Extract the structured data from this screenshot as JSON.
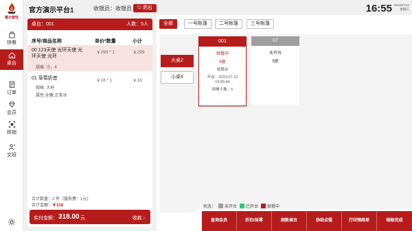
{
  "brand": {
    "logo_text": "蜀大智饮"
  },
  "sidebar": {
    "items": [
      {
        "label": "快餐",
        "icon": "fast-food-icon",
        "active": false
      },
      {
        "label": "桌台",
        "icon": "home-icon",
        "active": true
      },
      {
        "label": "订单",
        "icon": "receipt-icon",
        "active": false
      },
      {
        "label": "会员",
        "icon": "diamond-icon",
        "active": false
      },
      {
        "label": "核销",
        "icon": "scan-icon",
        "active": false
      },
      {
        "label": "交班",
        "icon": "user-shift-icon",
        "active": false
      }
    ],
    "bottom_icon": "gear-icon"
  },
  "header": {
    "title": "官方演示平台1",
    "cashier": "收银员：收银员",
    "logout": "退出",
    "time": "16:55",
    "date": "2023/07/12",
    "weekday": "星期三"
  },
  "order": {
    "table_label": "桌台：001",
    "people_label": "人数：5人",
    "columns": {
      "name": "序号/商品名称",
      "price_qty": "单价*数量",
      "subtotal": "小计"
    },
    "items": [
      {
        "name": "00 123天使 光环天使 光环天使 光环",
        "price_qty": "￥299 * 1",
        "subtotal": "￥299",
        "spec": "规格: 冷，4",
        "attrs": "",
        "selected": true
      },
      {
        "name": "01 草莓奶昔",
        "price_qty": "￥18 * 1",
        "subtotal": "￥18",
        "spec": "规格: 大杯",
        "attrs": "属性:全糖,正常冰",
        "selected": false
      }
    ],
    "total_qty": "合计数量：2 件（服务费：1元）",
    "total_amount_label": "合计金额：",
    "total_amount": "￥318",
    "pay_label": "实付金额：",
    "pay_amount": "318.00",
    "pay_unit": "元",
    "pay_button": "收款"
  },
  "areas": {
    "tabs": [
      {
        "label": "全部",
        "active": true
      },
      {
        "label": "一号帐篷",
        "active": false
      },
      {
        "label": "二号帐篷",
        "active": false
      },
      {
        "label": "三号帐篷",
        "active": false
      }
    ],
    "zones": [
      {
        "label": "大桌2",
        "active": true
      },
      {
        "label": "小桌4",
        "active": false
      }
    ]
  },
  "tables": [
    {
      "number": "001",
      "status": "就餐中",
      "seats": "5座",
      "cashier": "收银台",
      "open_label": "开台：",
      "open_date": "2023-07-12",
      "open_time": "16:55:44",
      "diners": "用餐人数：5",
      "busy": true
    },
    {
      "number": "07",
      "status": "未开台",
      "seats": "5座",
      "busy": false
    }
  ],
  "legend": {
    "label": "状态：",
    "items": [
      {
        "label": "未开台",
        "color": "#9e9e9e"
      },
      {
        "label": "已开台",
        "color": "#2ecc71"
      },
      {
        "label": "就餐中",
        "color": "#b71c1c"
      }
    ]
  },
  "actions": [
    "查询会员",
    "折扣/抹零",
    "刷新桌台",
    "协助点餐",
    "打印预结单",
    "结账完成"
  ],
  "colors": {
    "primary": "#b71c1c",
    "selected_row": "#f7e1e1",
    "idle": "#9e9e9e",
    "opened": "#2ecc71"
  }
}
